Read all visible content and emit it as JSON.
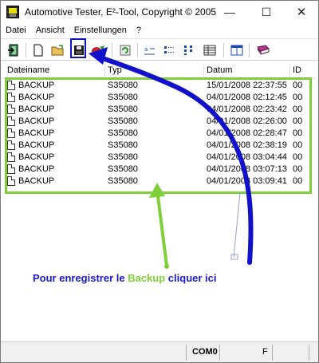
{
  "window": {
    "title": "Automotive Tester, E²-Tool,  Copyright © 2005",
    "min_glyph": "—",
    "max_glyph": "☐",
    "close_glyph": "✕"
  },
  "menu": [
    "Datei",
    "Ansicht",
    "Einstellungen",
    "?"
  ],
  "toolbar": {
    "icons": [
      "exit-door-icon",
      "new-file-icon",
      "open-folder-icon",
      "save-floppy-icon",
      "record-icon",
      "refresh-icon",
      "small-icons-view-icon",
      "list-view-icon",
      "tree-view-icon",
      "details-view-icon",
      "window-icon",
      "book-icon"
    ]
  },
  "list": {
    "columns": [
      "Dateiname",
      "Typ",
      "Datum",
      "ID"
    ],
    "rows": [
      {
        "name": "BACKUP",
        "type": "S35080",
        "date": "15/01/2008 22:37:55",
        "id": "00"
      },
      {
        "name": "BACKUP",
        "type": "S35080",
        "date": "04/01/2008 02:12:45",
        "id": "00"
      },
      {
        "name": "BACKUP",
        "type": "S35080",
        "date": "04/01/2008 02:23:42",
        "id": "00"
      },
      {
        "name": "BACKUP",
        "type": "S35080",
        "date": "04/01/2008 02:26:00",
        "id": "00"
      },
      {
        "name": "BACKUP",
        "type": "S35080",
        "date": "04/01/2008 02:28:47",
        "id": "00"
      },
      {
        "name": "BACKUP",
        "type": "S35080",
        "date": "04/01/2008 02:38:19",
        "id": "00"
      },
      {
        "name": "BACKUP",
        "type": "S35080",
        "date": "04/01/2008 03:04:44",
        "id": "00"
      },
      {
        "name": "BACKUP",
        "type": "S35080",
        "date": "04/01/2008 03:07:13",
        "id": "00"
      },
      {
        "name": "BACKUP",
        "type": "S35080",
        "date": "04/01/2008 03:09:41",
        "id": "00"
      }
    ]
  },
  "annotation": {
    "prefix": "Pour enregistrer le ",
    "keyword": "Backup",
    "suffix": " cliquer ici",
    "text_color": "#1a1acc",
    "keyword_color": "#7fcf3a",
    "arrow_blue": "#1111cc",
    "arrow_green": "#7fcf3a"
  },
  "status": {
    "port": "COM0",
    "mark": "F"
  }
}
